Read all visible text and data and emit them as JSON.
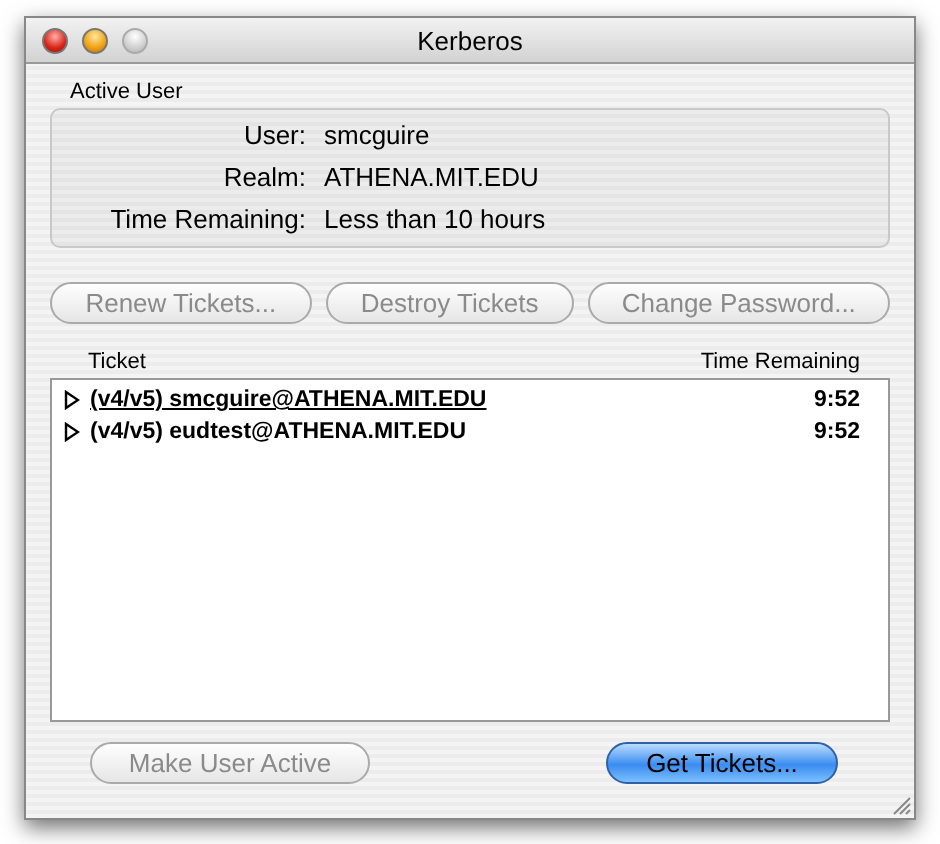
{
  "window": {
    "title": "Kerberos"
  },
  "active_user": {
    "title": "Active User",
    "fields": [
      {
        "label": "User:",
        "value": "smcguire"
      },
      {
        "label": "Realm:",
        "value": "ATHENA.MIT.EDU"
      },
      {
        "label": "Time Remaining:",
        "value": "Less than 10 hours"
      }
    ]
  },
  "actions": [
    {
      "label": "Renew Tickets...",
      "disabled": true
    },
    {
      "label": "Destroy Tickets",
      "disabled": true
    },
    {
      "label": "Change Password...",
      "disabled": true
    }
  ],
  "table": {
    "columns": [
      "Ticket",
      "Time Remaining"
    ],
    "rows": [
      {
        "ticket": "(v4/v5) smcguire@ATHENA.MIT.EDU",
        "time": "9:52",
        "active": true,
        "expanded": false
      },
      {
        "ticket": "(v4/v5) eudtest@ATHENA.MIT.EDU",
        "time": "9:52",
        "active": false,
        "expanded": false
      }
    ]
  },
  "footer_buttons": [
    {
      "label": "Make User Active",
      "disabled": true,
      "default": false
    },
    {
      "label": "Get Tickets...",
      "disabled": false,
      "default": true
    }
  ]
}
